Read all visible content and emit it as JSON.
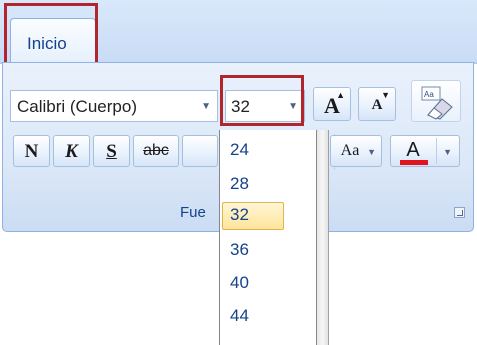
{
  "tabs": [
    {
      "label": "Inicio",
      "active": true
    }
  ],
  "font_group": {
    "font_name_value": "Calibri (Cuerpo)",
    "font_size_value": "32",
    "grow_font_glyph": "A",
    "shrink_font_glyph": "A",
    "bold_glyph": "N",
    "italic_glyph": "K",
    "underline_glyph": "S",
    "strikethrough_glyph": "abc",
    "change_case_glyph": "Aa",
    "font_color_glyph": "A",
    "group_label_visible": "Fue"
  },
  "size_dropdown": {
    "items": [
      "24",
      "28",
      "32",
      "36",
      "40",
      "44"
    ],
    "selected": "32"
  },
  "colors": {
    "highlight_box": "#b0262c",
    "font_color_bar": "#e0141e",
    "selected_item": "#ffe59a",
    "ribbon_text": "#15428b"
  }
}
